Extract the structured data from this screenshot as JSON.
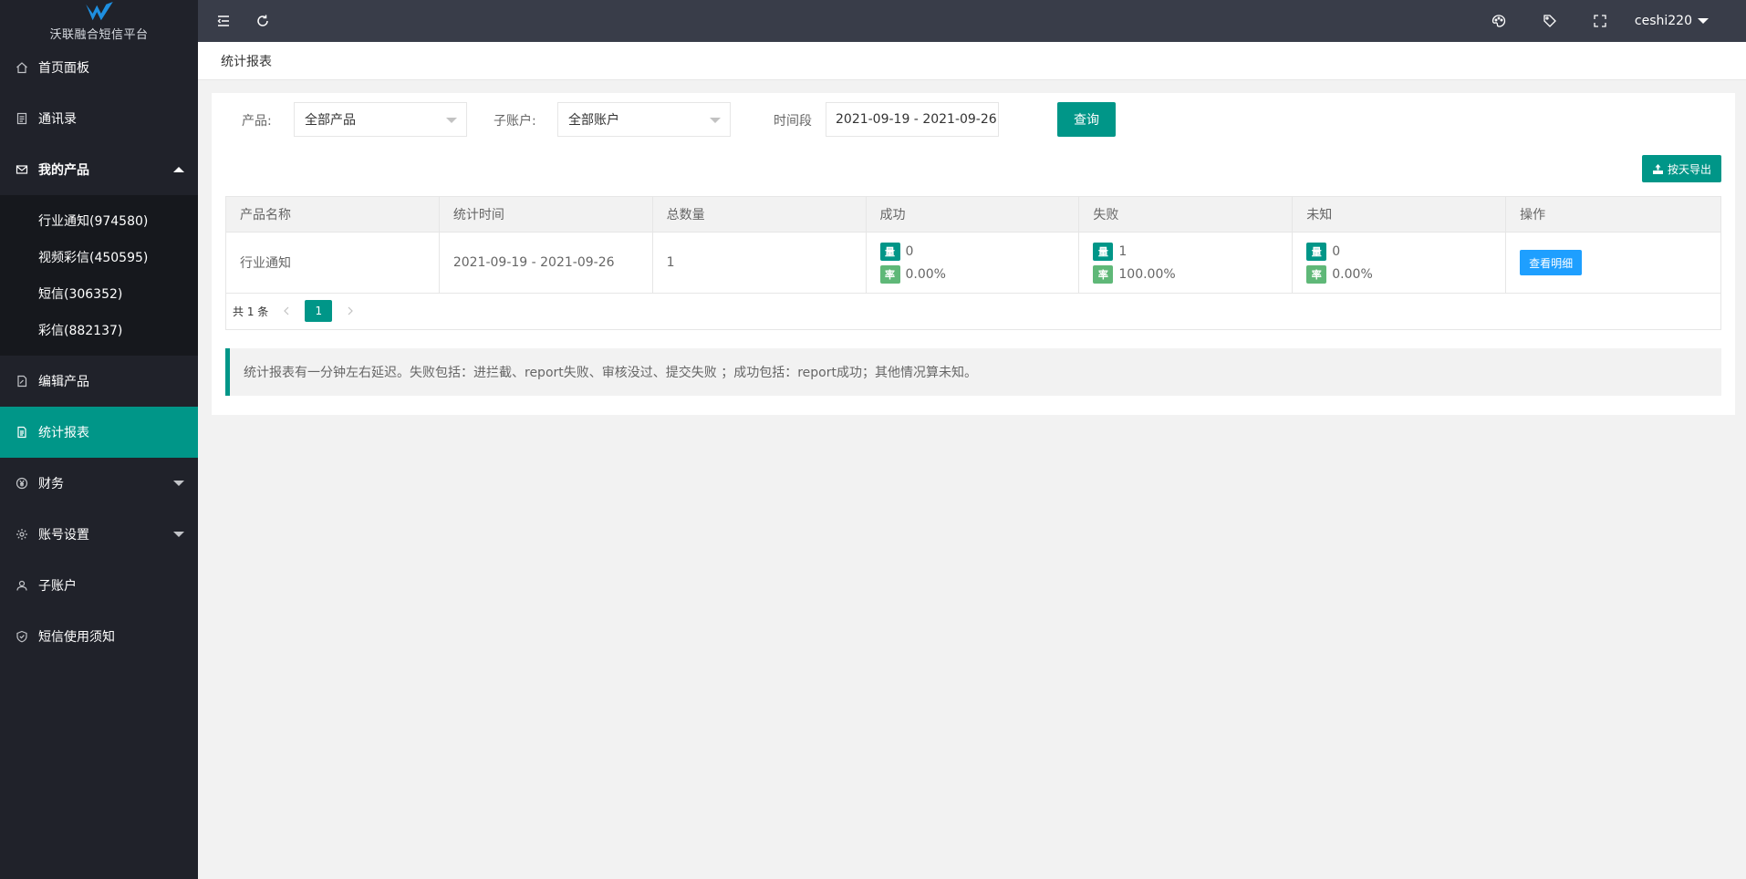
{
  "brand": {
    "name": "沃联融合短信平台",
    "accent": "#009688"
  },
  "sidebar": {
    "items": [
      {
        "label": "首页面板",
        "icon": "home-icon"
      },
      {
        "label": "通讯录",
        "icon": "contacts-icon"
      },
      {
        "label": "我的产品",
        "icon": "mail-icon"
      },
      {
        "label": "编辑产品",
        "icon": "edit-doc-icon"
      },
      {
        "label": "统计报表",
        "icon": "report-icon"
      },
      {
        "label": "财务",
        "icon": "yen-icon"
      },
      {
        "label": "账号设置",
        "icon": "gear-icon"
      },
      {
        "label": "子账户",
        "icon": "user-icon"
      },
      {
        "label": "短信使用须知",
        "icon": "shield-icon"
      }
    ],
    "products": [
      "行业通知(974580)",
      "视频彩信(450595)",
      "短信(306352)",
      "彩信(882137)"
    ]
  },
  "header": {
    "user": "ceshi220"
  },
  "breadcrumb": "统计报表",
  "filters": {
    "product_label": "产品:",
    "product_value": "全部产品",
    "account_label": "子账户:",
    "account_value": "全部账户",
    "period_label": "时间段",
    "period_value": "2021-09-19 - 2021-09-26",
    "query_label": "查询",
    "export_label": "按天导出"
  },
  "table": {
    "headers": [
      "产品名称",
      "统计时间",
      "总数量",
      "成功",
      "失败",
      "未知",
      "操作"
    ],
    "tag_qty": "量",
    "tag_rate": "率",
    "rows": [
      {
        "name": "行业通知",
        "period": "2021-09-19 - 2021-09-26",
        "total": "1",
        "success_qty": "0",
        "success_rate": "0.00%",
        "fail_qty": "1",
        "fail_rate": "100.00%",
        "unknown_qty": "0",
        "unknown_rate": "0.00%",
        "action": "查看明细"
      }
    ]
  },
  "pagination": {
    "total": "共 1 条",
    "current": "1"
  },
  "note": "统计报表有一分钟左右延迟。失败包括：进拦截、report失败、审核没过、提交失败 ；成功包括：report成功；其他情况算未知。"
}
